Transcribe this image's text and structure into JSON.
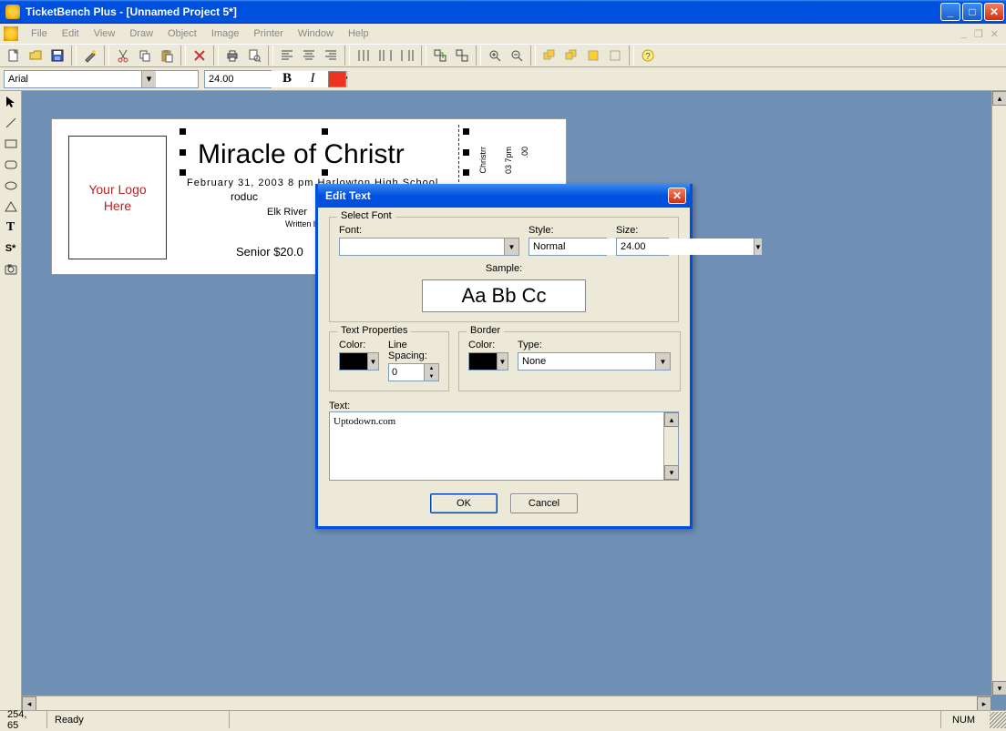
{
  "titlebar": {
    "app": "TicketBench Plus",
    "doc": " - [Unnamed Project 5*]"
  },
  "menus": [
    "File",
    "Edit",
    "View",
    "Draw",
    "Object",
    "Image",
    "Printer",
    "Window",
    "Help"
  ],
  "formatbar": {
    "font": "Arial",
    "size": "24.00",
    "bold": "B",
    "italic": "I"
  },
  "ticket": {
    "logo": "Your Logo\nHere",
    "title": "Miracle of Christr",
    "subtitle": "February 31, 2003  8 pm  Harlowton High School",
    "line3": "roduc",
    "line4": "Elk River",
    "line5": "Written by",
    "line6": "Senior $20.0",
    "stub1": "Christrr",
    "stub2": "03 7pm",
    "stub3": ".00"
  },
  "dialog": {
    "title": "Edit Text",
    "font_group": "Select Font",
    "font_label": "Font:",
    "style_label": "Style:",
    "size_label": "Size:",
    "font_value": "",
    "style_value": "Normal",
    "size_value": "24.00",
    "sample_label": "Sample:",
    "sample_text": "Aa Bb Cc",
    "textprops_group": "Text Properties",
    "color_label": "Color:",
    "linespacing_label": "Line Spacing:",
    "linespacing_value": "0",
    "border_group": "Border",
    "border_color_label": "Color:",
    "border_type_label": "Type:",
    "border_type_value": "None",
    "text_label": "Text:",
    "text_value": "Uptodown.com",
    "ok": "OK",
    "cancel": "Cancel"
  },
  "statusbar": {
    "coords": "254, 65",
    "ready": "Ready",
    "num": "NUM"
  }
}
